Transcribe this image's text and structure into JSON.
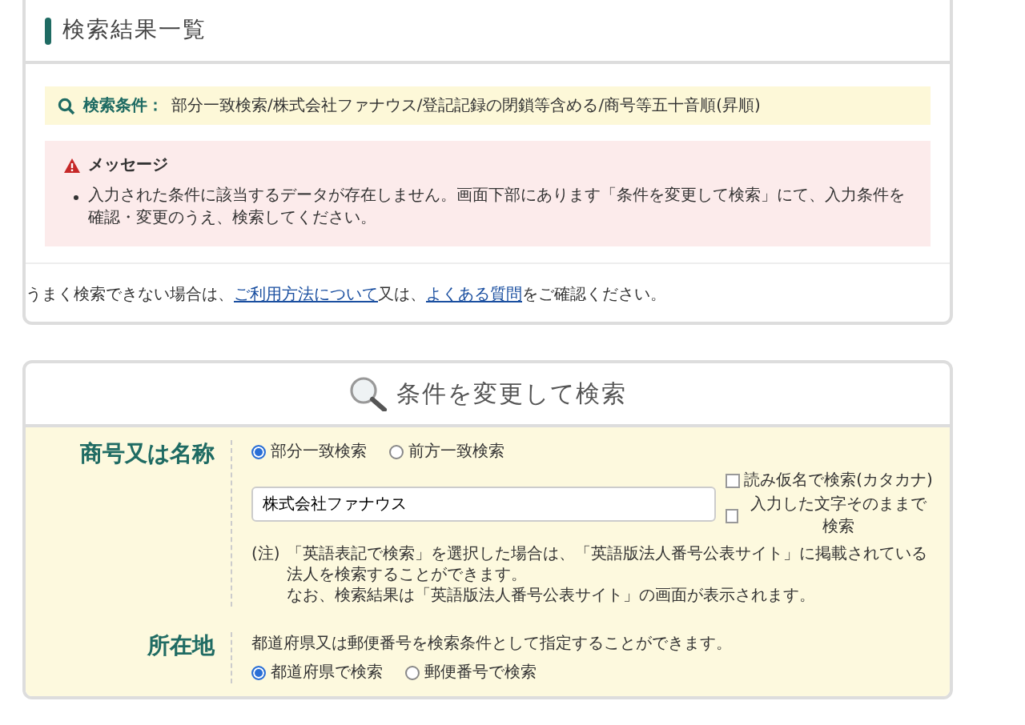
{
  "results": {
    "title": "検索結果一覧",
    "conditions": {
      "label": "検索条件：",
      "value": "部分一致検索/株式会社ファナウス/登記記録の閉鎖等含める/商号等五十音順(昇順)"
    },
    "message": {
      "title": "メッセージ",
      "items": [
        "入力された条件に該当するデータが存在しません。画面下部にあります「条件を変更して検索」にて、入力条件を確認・変更のうえ、検索してください。"
      ]
    },
    "help": [
      {
        "kind": "text",
        "text": "うまく検索できない場合は、"
      },
      {
        "kind": "link",
        "text": "ご利用方法について"
      },
      {
        "kind": "text",
        "text": "又は、"
      },
      {
        "kind": "link",
        "text": "よくある質問"
      },
      {
        "kind": "text",
        "text": "をご確認ください。"
      }
    ]
  },
  "search_form": {
    "title": "条件を変更して検索",
    "rows": [
      {
        "label": "商号又は名称",
        "radios": [
          {
            "label": "部分一致検索",
            "selected": true
          },
          {
            "label": "前方一致検索",
            "selected": false
          }
        ],
        "input": {
          "value": "株式会社ファナウス"
        },
        "checkboxes": [
          {
            "label": "読み仮名で検索(カタカナ)",
            "checked": false
          },
          {
            "label": "入力した文字そのままで検索",
            "checked": false
          }
        ],
        "note_mark": "(注)",
        "notes": [
          "「英語表記で検索」を選択した場合は、「英語版法人番号公表サイト」に掲載されている法人を検索することができます。",
          "なお、検索結果は「英語版法人番号公表サイト」の画面が表示されます。"
        ]
      },
      {
        "label": "所在地",
        "description": "都道府県又は郵便番号を検索条件として指定することができます。",
        "radios": [
          {
            "label": "都道府県で検索",
            "selected": true
          },
          {
            "label": "郵便番号で検索",
            "selected": false
          }
        ]
      }
    ]
  }
}
